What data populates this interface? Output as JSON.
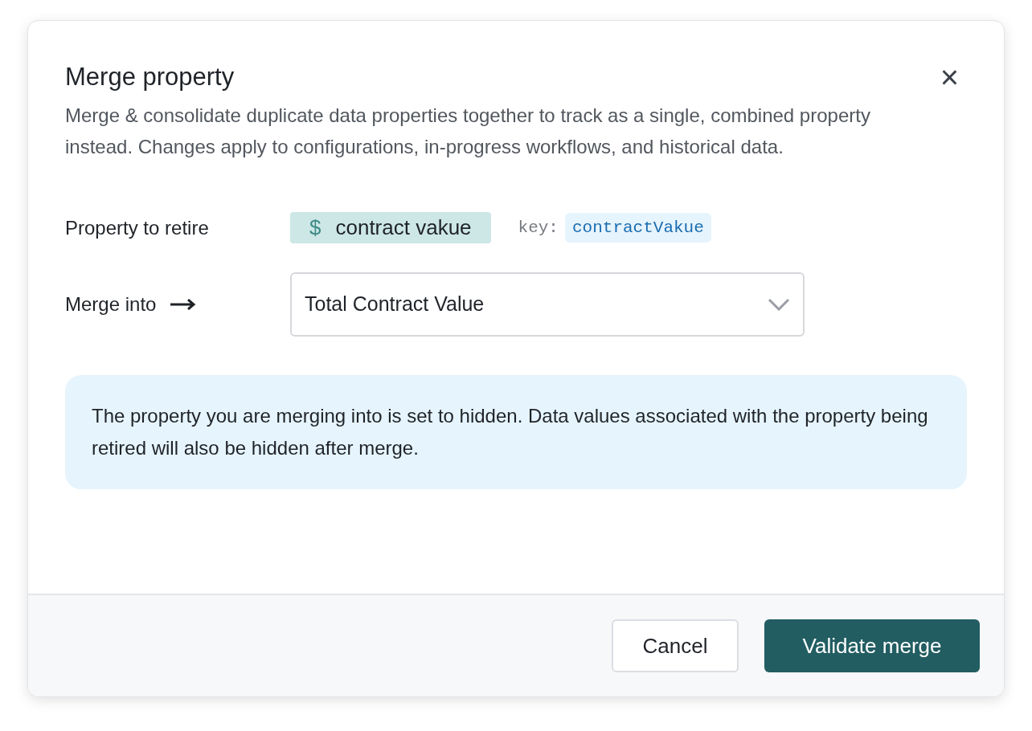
{
  "dialog": {
    "title": "Merge property",
    "close": "×",
    "description": "Merge & consolidate duplicate data properties together to track as a single, combined property instead. Changes apply to configurations, in-progress workflows, and historical data."
  },
  "retire": {
    "label": "Property to retire",
    "symbol": "$",
    "name": "contract vakue",
    "key_label": "key:",
    "key": "contractVakue"
  },
  "merge_into": {
    "label": "Merge into",
    "value": "Total Contract Value"
  },
  "notice": "The property you are merging into is set to hidden. Data values associated with the property being retired will also be hidden after merge.",
  "buttons": [
    {
      "label": "Cancel",
      "kind": "secondary"
    },
    {
      "label": "Validate merge",
      "kind": "primary"
    }
  ]
}
